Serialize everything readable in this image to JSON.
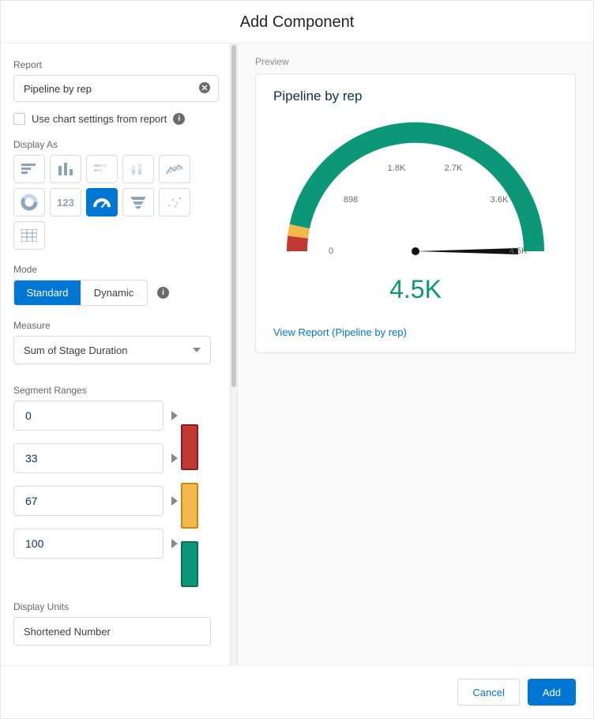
{
  "dialog": {
    "title": "Add Component"
  },
  "report": {
    "label": "Report",
    "value": "Pipeline by rep",
    "use_chart_settings_label": "Use chart settings from report"
  },
  "display_as": {
    "label": "Display As"
  },
  "mode": {
    "label": "Mode",
    "options": {
      "standard": "Standard",
      "dynamic": "Dynamic"
    },
    "selected": "Standard"
  },
  "measure": {
    "label": "Measure",
    "value": "Sum of Stage Duration"
  },
  "segment_ranges": {
    "label": "Segment Ranges",
    "values": [
      "0",
      "33",
      "67",
      "100"
    ],
    "colors": [
      "#c23934",
      "#f2b84b",
      "#0b9778"
    ]
  },
  "display_units": {
    "label": "Display Units",
    "value": "Shortened Number"
  },
  "preview": {
    "label": "Preview",
    "card_title": "Pipeline by rep",
    "value_text": "4.5K",
    "ticks": [
      "0",
      "898",
      "1.8K",
      "2.7K",
      "3.6K",
      "4.5K"
    ],
    "link_text": "View Report (Pipeline by rep)"
  },
  "chart_data": {
    "type": "gauge",
    "title": "Pipeline by rep",
    "range": [
      0,
      4500
    ],
    "value": 4500,
    "ticks": [
      0,
      898,
      1800,
      2700,
      3600,
      4500
    ],
    "segments": [
      {
        "from": 0,
        "to": 33,
        "color": "#c23934"
      },
      {
        "from": 33,
        "to": 67,
        "color": "#f2b84b"
      },
      {
        "from": 67,
        "to": 100,
        "color": "#0b9778"
      }
    ],
    "display_units": "Shortened Number"
  },
  "footer": {
    "cancel": "Cancel",
    "add": "Add"
  }
}
